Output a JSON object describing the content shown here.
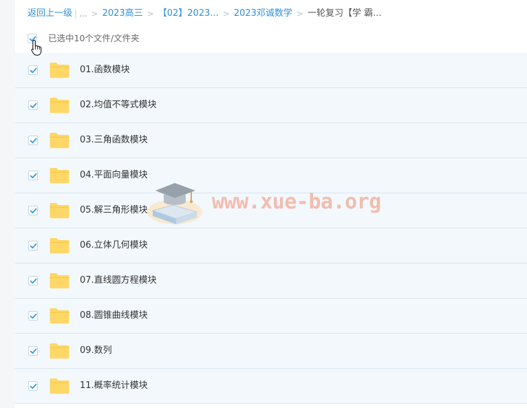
{
  "breadcrumb": {
    "back_label": "返回上一级",
    "ellipsis": "...",
    "items": [
      {
        "label": "2023高三"
      },
      {
        "label": "【02】2023..."
      },
      {
        "label": "2023邓诚数学"
      }
    ],
    "current": "一轮复习【学 霸..."
  },
  "selection": {
    "text": "已选中10个文件/文件夹",
    "checked": true
  },
  "files": [
    {
      "name": "01.函数模块",
      "checked": true
    },
    {
      "name": "02.均值不等式模块",
      "checked": true
    },
    {
      "name": "03.三角函数模块",
      "checked": true
    },
    {
      "name": "04.平面向量模块",
      "checked": true
    },
    {
      "name": "05.解三角形模块",
      "checked": true
    },
    {
      "name": "06.立体几何模块",
      "checked": true
    },
    {
      "name": "07.直线圆方程模块",
      "checked": true
    },
    {
      "name": "08.圆锥曲线模块",
      "checked": true
    },
    {
      "name": "09.数列",
      "checked": true
    },
    {
      "name": "11.概率统计模块",
      "checked": true
    }
  ],
  "watermark": {
    "text": "www.xue-ba.org"
  },
  "colors": {
    "link": "#2f8fd8",
    "check": "#2a9de6",
    "folder": "#ffd766",
    "row_background": "#f2f8fc",
    "row_border": "#d9e6f2",
    "watermark": "#f3b8a9"
  },
  "icons": {
    "folder": "folder-icon",
    "check": "check-icon",
    "cursor": "hand-pointer-icon",
    "watermark_logo": "graduation-cap-book-icon"
  }
}
